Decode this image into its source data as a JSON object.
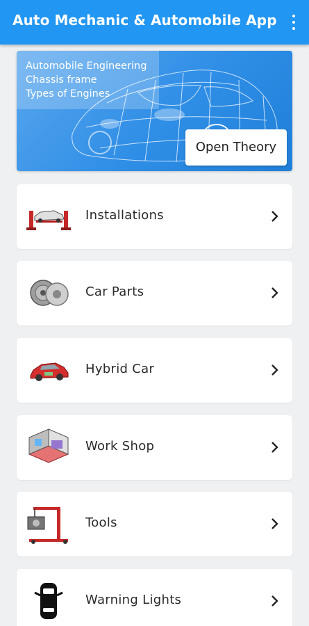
{
  "appbar": {
    "title": "Auto Mechanic & Automobile App",
    "menu_icon": "more-vert-icon",
    "color": "#2196f3"
  },
  "banner": {
    "lines": [
      "Automobile Engineering",
      "Chassis frame",
      "Types of Engines"
    ],
    "button_label": "Open Theory",
    "art_icon": "wireframe-car-icon"
  },
  "menu": {
    "items": [
      {
        "label": "Installations",
        "icon": "car-lift-icon"
      },
      {
        "label": "Car Parts",
        "icon": "car-parts-icon"
      },
      {
        "label": "Hybrid Car",
        "icon": "hybrid-car-icon"
      },
      {
        "label": "Work Shop",
        "icon": "workshop-icon"
      },
      {
        "label": "Tools",
        "icon": "engine-hoist-icon"
      },
      {
        "label": "Warning Lights",
        "icon": "car-top-view-icon"
      }
    ],
    "chevron_icon": "chevron-right-icon"
  }
}
